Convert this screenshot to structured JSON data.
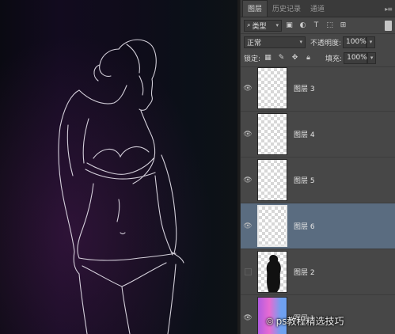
{
  "panel": {
    "tabs": [
      "图层",
      "历史记录",
      "通道"
    ],
    "filter_label": "类型",
    "blend_mode": "正常",
    "opacity_label": "不透明度:",
    "opacity_value": "100%",
    "lock_label": "锁定:",
    "fill_label": "填充:",
    "fill_value": "100%",
    "layers": [
      {
        "name": "图层 3",
        "visible": true,
        "selected": false
      },
      {
        "name": "图层 4",
        "visible": true,
        "selected": false
      },
      {
        "name": "图层 5",
        "visible": true,
        "selected": false
      },
      {
        "name": "图层 6",
        "visible": true,
        "selected": true
      },
      {
        "name": "图层 2",
        "visible": false,
        "selected": false
      },
      {
        "name": "图层 1",
        "visible": true,
        "selected": false
      }
    ]
  },
  "watermark": {
    "text": "ps教程精选技巧"
  },
  "colors": {
    "panel_bg": "#474747",
    "selected_row": "#5a6c80"
  }
}
